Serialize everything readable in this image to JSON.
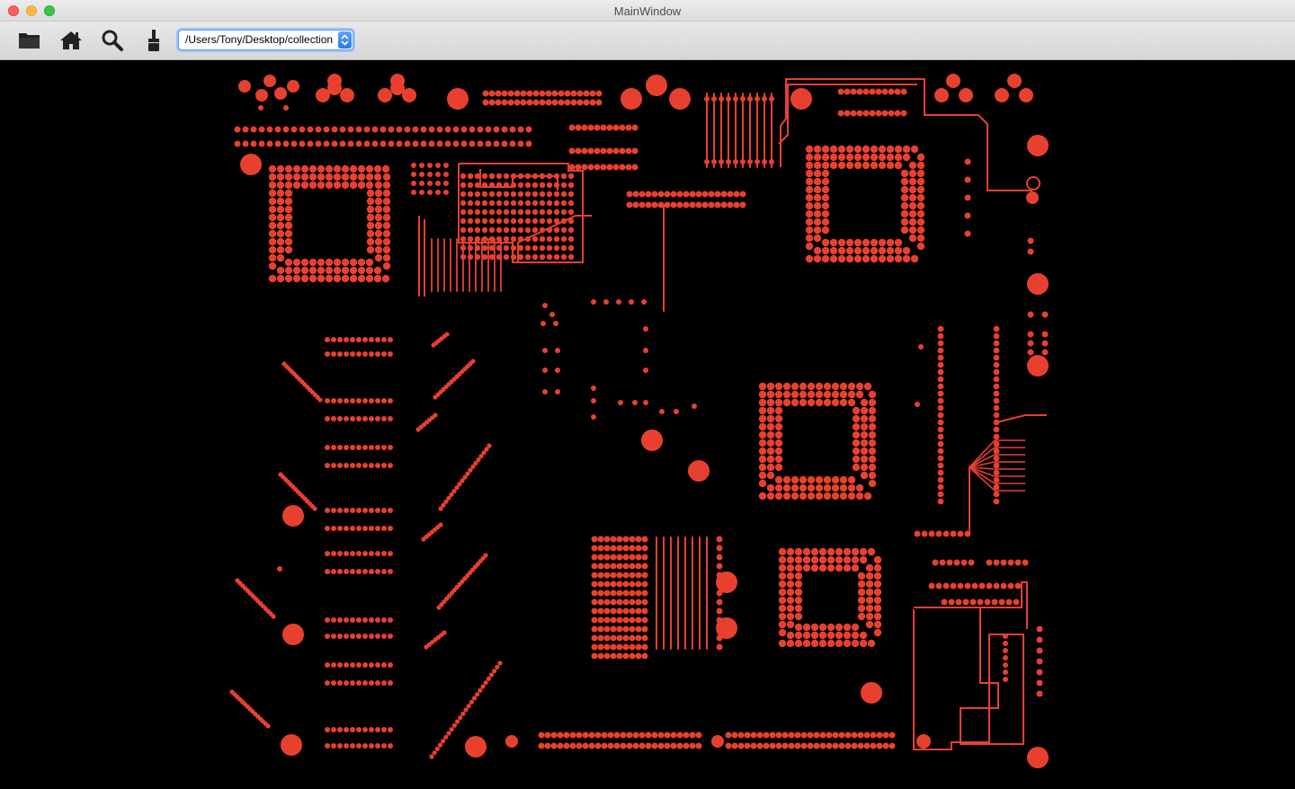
{
  "window": {
    "title": "MainWindow"
  },
  "toolbar": {
    "buttons": [
      {
        "icon": "folder-icon",
        "action": "open"
      },
      {
        "icon": "home-icon",
        "action": "home"
      },
      {
        "icon": "search-icon",
        "action": "zoom"
      },
      {
        "icon": "brush-icon",
        "action": "clear"
      }
    ],
    "path_value": "/Users/Tony/Desktop/collection"
  },
  "board": {
    "copper_color": "#e8402f",
    "background_color": "#000000"
  }
}
